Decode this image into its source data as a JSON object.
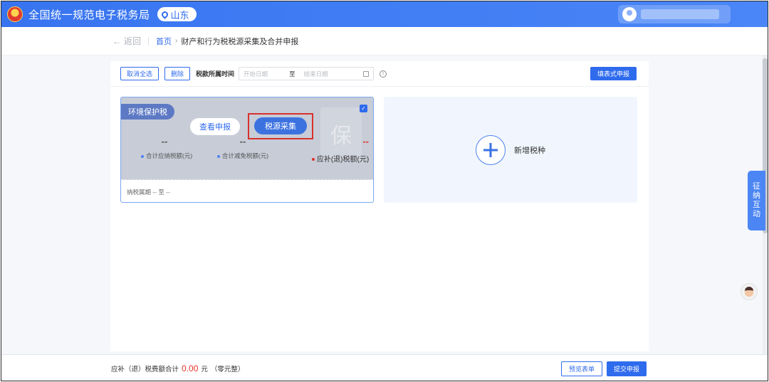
{
  "header": {
    "app_title": "全国统一规范电子税务局",
    "region": "山东"
  },
  "breadcrumb": {
    "back": "返回",
    "home": "首页",
    "separator": "›",
    "current": "财产和行为税税源采集及合并申报"
  },
  "toolbar": {
    "cancel_select_all": "取消全选",
    "delete": "删除",
    "period_label": "税款所属时间",
    "start_placeholder": "开始日期",
    "to": "至",
    "end_placeholder": "结束日期",
    "info_icon": "ⓘ",
    "form_declare": "填表式申报"
  },
  "tax_card": {
    "tax_name": "环境保护税",
    "checked": true,
    "checkbox_glyph": "✓",
    "watermark": "保",
    "view_declaration": "查看申报",
    "source_collection": "税源采集",
    "metrics": [
      {
        "value": "--",
        "label": "合计应纳税额(元)",
        "dot_color": "#4d82ef"
      },
      {
        "value": "--",
        "label": "合计减免税额(元)",
        "dot_color": "#4d82ef"
      },
      {
        "value": "--",
        "label": "应补(退)税额(元)",
        "dot_color": "#e5322d"
      }
    ],
    "period_text": "纳税属期 -- 至 --"
  },
  "add_card": {
    "label": "新增税种"
  },
  "side": {
    "interaction_tab": [
      "征",
      "纳",
      "互",
      "动"
    ]
  },
  "footer": {
    "total_label": "应补（退）税费额合计",
    "amount": "0.00",
    "unit": "元",
    "amount_words": "（零元整）",
    "preview": "预览表单",
    "submit": "提交申报"
  },
  "colors": {
    "primary": "#2f6bed",
    "header": "#3874f0",
    "highlight_border": "#d9302c",
    "amount_red": "#e5322d"
  }
}
